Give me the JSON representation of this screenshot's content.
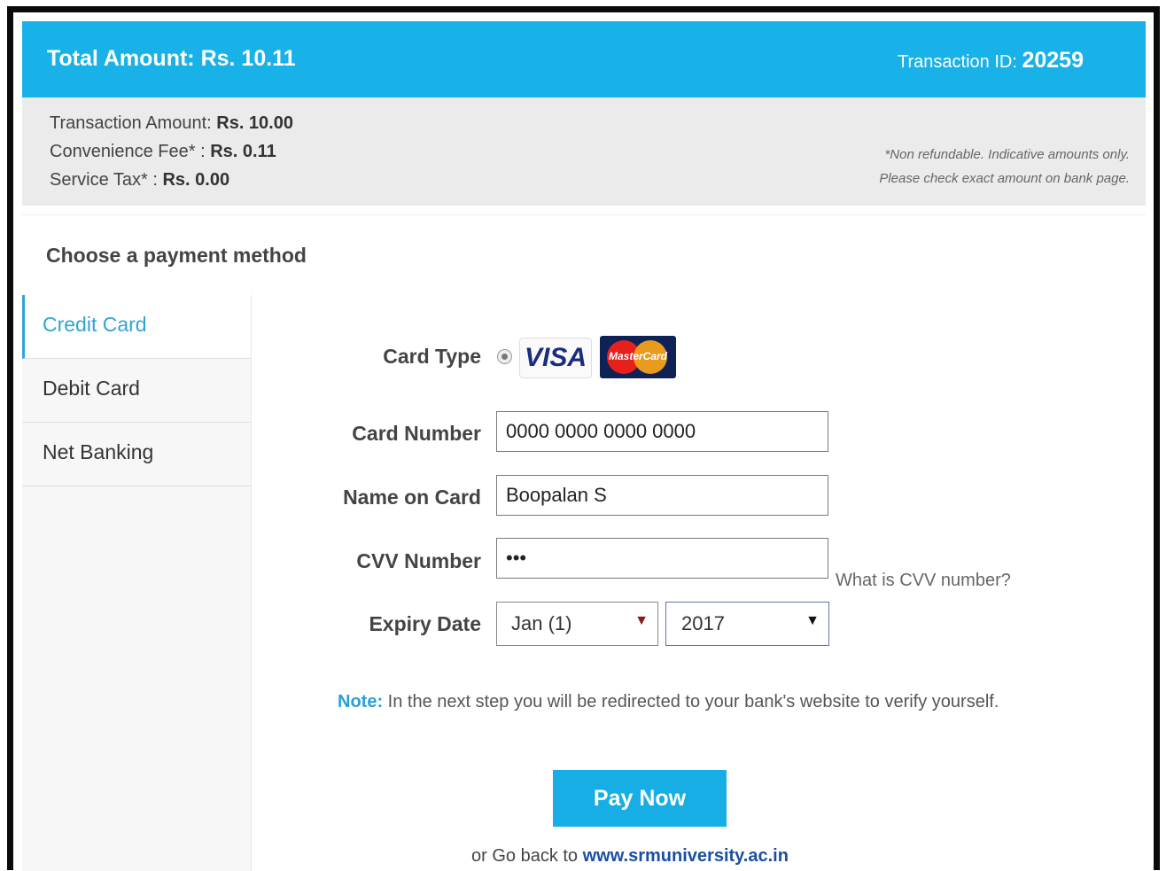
{
  "header": {
    "total_label": "Total Amount: ",
    "total_value": "Rs. 10.11",
    "txn_label": "Transaction ID: ",
    "txn_value": "20259"
  },
  "summary": {
    "transaction_amount_label": "Transaction Amount: ",
    "transaction_amount_value": "Rs. 10.00",
    "convenience_fee_label": "Convenience Fee* : ",
    "convenience_fee_value": "Rs. 0.11",
    "service_tax_label": "Service Tax* : ",
    "service_tax_value": "Rs. 0.00",
    "disclaimer_line1": "*Non refundable. Indicative amounts only.",
    "disclaimer_line2": "Please check exact amount on bank page."
  },
  "payment": {
    "title": "Choose a payment method",
    "methods": [
      {
        "label": "Credit Card",
        "active": true
      },
      {
        "label": "Debit Card",
        "active": false
      },
      {
        "label": "Net Banking",
        "active": false
      }
    ]
  },
  "form": {
    "card_type_label": "Card Type",
    "visa_text": "VISA",
    "mastercard_text": "MasterCard",
    "card_number_label": "Card Number",
    "card_number_value": "0000 0000 0000 0000",
    "name_label": "Name on Card",
    "name_value": "Boopalan S",
    "cvv_label": "CVV Number",
    "cvv_value": "•••",
    "cvv_help": "What is CVV number?",
    "expiry_label": "Expiry Date",
    "expiry_month": "Jan (1)",
    "expiry_year": "2017"
  },
  "note": {
    "prefix": "Note:",
    "text": " In the next step you will be redirected to your bank's website to verify yourself."
  },
  "actions": {
    "pay_label": "Pay Now",
    "back_prefix": "or Go back to ",
    "back_link": "www.srmuniversity.ac.in"
  },
  "colors": {
    "header_bg": "#18b1e8",
    "accent": "#30a4d3",
    "button_bg": "#17aee5",
    "link": "#1c4fa0"
  }
}
